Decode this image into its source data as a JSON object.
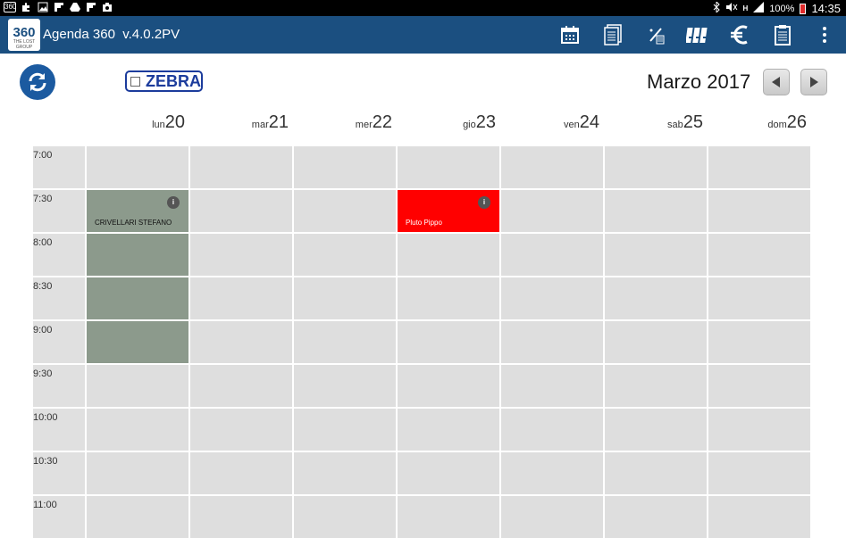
{
  "status_bar": {
    "icons_left": [
      "app-icon-360",
      "puzzle-icon",
      "image-icon",
      "flipboard-icon",
      "drive-icon",
      "flipboard-icon",
      "keyboard-icon",
      "camera-icon"
    ],
    "app_icon_text": "360",
    "icons_right": [
      "bluetooth-icon",
      "mute-icon",
      "network-type-icon",
      "signal-icon"
    ],
    "network_text": "H",
    "battery_percent": "100%",
    "time": "14:35"
  },
  "app_bar": {
    "logo_text": "360",
    "logo_subtext": "THE LOST GROUP",
    "title": "Agenda 360  v.4.0.2PV",
    "bg_color": "#1b4f80",
    "tools": [
      "calendar-icon",
      "documents-icon",
      "percent-icon",
      "archive-icon",
      "euro-icon",
      "clipboard-icon",
      "overflow-menu-icon"
    ]
  },
  "toolbar": {
    "zebra_label": "ZEBRA",
    "zebra_checked": false,
    "month_label": "Marzo 2017"
  },
  "calendar": {
    "days": [
      {
        "name": "lun",
        "num": "20"
      },
      {
        "name": "mar",
        "num": "21"
      },
      {
        "name": "mer",
        "num": "22"
      },
      {
        "name": "gio",
        "num": "23"
      },
      {
        "name": "ven",
        "num": "24"
      },
      {
        "name": "sab",
        "num": "25"
      },
      {
        "name": "dom",
        "num": "26"
      }
    ],
    "times": [
      "7:00",
      "7:30",
      "8:00",
      "8:30",
      "9:00",
      "9:30",
      "10:00",
      "10:30",
      "11:00"
    ],
    "events": [
      {
        "label": "CRIVELLARI STEFANO",
        "day_index": 0,
        "start_slot": 1,
        "slots": 4,
        "color": "#8c9a8c",
        "has_info": true
      },
      {
        "label": "Pluto Pippo",
        "day_index": 3,
        "start_slot": 1,
        "slots": 1,
        "color": "#ff0000",
        "has_info": true
      }
    ],
    "info_badge": "i"
  }
}
